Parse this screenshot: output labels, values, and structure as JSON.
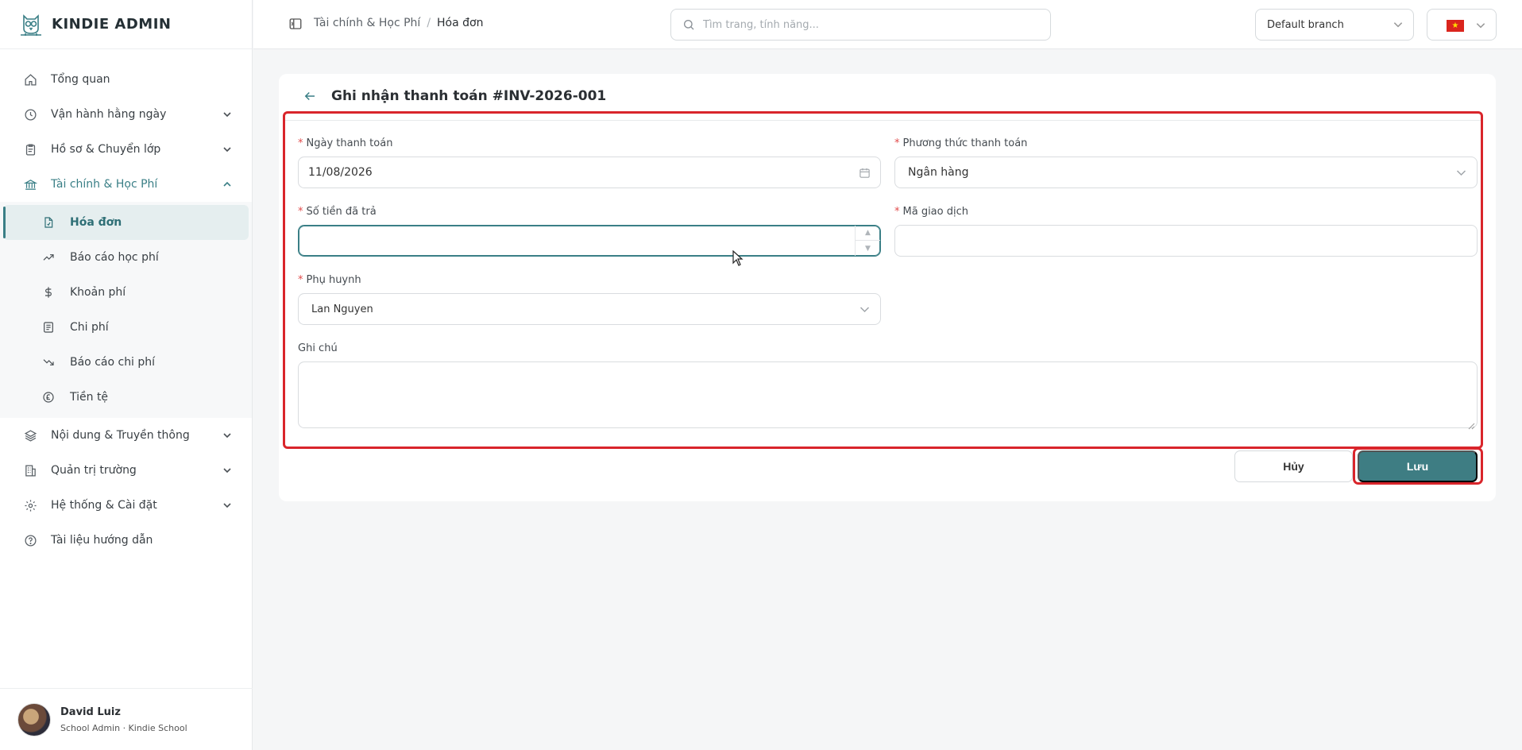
{
  "app": {
    "name": "KINDIE ADMIN"
  },
  "sidebar": {
    "items": [
      {
        "label": "Tổng quan",
        "icon": "home-icon"
      },
      {
        "label": "Vận hành hằng ngày",
        "icon": "clock-icon"
      },
      {
        "label": "Hồ sơ & Chuyển lớp",
        "icon": "clipboard-icon"
      },
      {
        "label": "Tài chính & Học Phí",
        "icon": "bank-icon"
      },
      {
        "label": "Nội dung & Truyền thông",
        "icon": "layers-icon"
      },
      {
        "label": "Quản trị trường",
        "icon": "building-icon"
      },
      {
        "label": "Hệ thống & Cài đặt",
        "icon": "gear-icon"
      },
      {
        "label": "Tài liệu hướng dẫn",
        "icon": "help-circle-icon"
      }
    ],
    "finance_sub": [
      {
        "label": "Hóa đơn",
        "icon": "invoice-icon"
      },
      {
        "label": "Báo cáo học phí",
        "icon": "trending-up-icon"
      },
      {
        "label": "Khoản phí",
        "icon": "dollar-icon"
      },
      {
        "label": "Chi phí",
        "icon": "receipt-icon"
      },
      {
        "label": "Báo cáo chi phí",
        "icon": "trending-down-icon"
      },
      {
        "label": "Tiền tệ",
        "icon": "currency-icon"
      }
    ]
  },
  "user": {
    "name": "David Luiz",
    "role": "School Admin · Kindie School"
  },
  "topbar": {
    "breadcrumb": [
      "Tài chính & Học Phí",
      "Hóa đơn"
    ],
    "breadcrumb_sep": "/",
    "search_placeholder": "Tìm trang, tính năng...",
    "branch": "Default branch",
    "language_flag": "VN"
  },
  "form": {
    "title": "Ghi nhận thanh toán #INV-2026-001",
    "payment_date_label": "Ngày thanh toán",
    "payment_date_value": "11/08/2026",
    "payment_method_label": "Phương thức thanh toán",
    "payment_method_value": "Ngân hàng",
    "amount_label": "Số tiền đã trả",
    "amount_value": "",
    "transaction_code_label": "Mã giao dịch",
    "transaction_code_value": "",
    "parent_label": "Phụ huynh",
    "parent_value": "Lan Nguyen",
    "note_label": "Ghi chú",
    "note_value": "",
    "required_mark": "*",
    "cancel_label": "Hủy",
    "save_label": "Lưu"
  },
  "colors": {
    "accent": "#3e7d83",
    "highlight": "#d9252b"
  }
}
